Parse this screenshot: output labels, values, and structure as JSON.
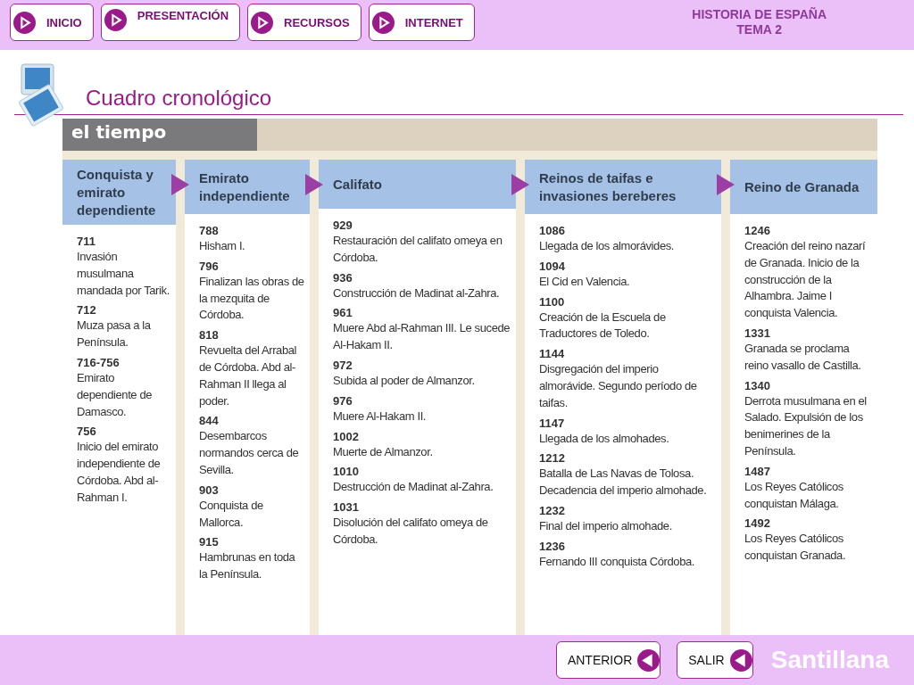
{
  "nav": [
    {
      "label": "INICIO"
    },
    {
      "label": "PRESENTACIÓN"
    },
    {
      "label": "RECURSOS"
    },
    {
      "label": "INTERNET"
    }
  ],
  "course": {
    "title": "HISTORIA DE ESPAÑA",
    "subtitle": "TEMA 2"
  },
  "page_title": "Cuadro cronológico",
  "band_label": "el tiempo",
  "columns": [
    {
      "heading": "Conquista y emirato dependiente",
      "events": [
        {
          "year": "711",
          "text": "Invasión musulmana mandada por Tarik."
        },
        {
          "year": "712",
          "text": "Muza pasa a la Península."
        },
        {
          "year": "716-756",
          "text": "Emirato dependiente de Damasco."
        },
        {
          "year": "756",
          "text": "Inicio del emirato independiente de Córdoba. Abd al-Rahman I."
        }
      ]
    },
    {
      "heading": "Emirato independiente",
      "events": [
        {
          "year": "788",
          "text": "Hisham I."
        },
        {
          "year": "796",
          "text": "Finalizan las obras de la mezquita de Córdoba."
        },
        {
          "year": "818",
          "text": "Revuelta del Arrabal de Córdoba. Abd al-Rahman II llega al poder."
        },
        {
          "year": "844",
          "text": "Desembarcos normandos cerca de Sevilla."
        },
        {
          "year": "903",
          "text": "Conquista de Mallorca."
        },
        {
          "year": "915",
          "text": "Hambrunas en toda la Península."
        }
      ]
    },
    {
      "heading": "Califato",
      "events": [
        {
          "year": "929",
          "text": "Restauración del califato omeya en Córdoba."
        },
        {
          "year": "936",
          "text": "Construcción de Madinat al-Zahra."
        },
        {
          "year": "961",
          "text": "Muere Abd al-Rahman III. Le sucede Al-Hakam II."
        },
        {
          "year": "972",
          "text": "Subida al poder de Almanzor."
        },
        {
          "year": "976",
          "text": "Muere Al-Hakam II."
        },
        {
          "year": "1002",
          "text": "Muerte de Almanzor."
        },
        {
          "year": "1010",
          "text": "Destrucción de Madinat al-Zahra."
        },
        {
          "year": "1031",
          "text": "Disolución del califato omeya de Córdoba."
        }
      ]
    },
    {
      "heading": "Reinos de taifas e invasiones bereberes",
      "events": [
        {
          "year": "1086",
          "text": "Llegada de los almorávides."
        },
        {
          "year": "1094",
          "text": "El Cid en Valencia."
        },
        {
          "year": "1100",
          "text": "Creación de la Escuela de Traductores de Toledo."
        },
        {
          "year": "1144",
          "text": "Disgregación del imperio almorávide. Segundo período de taifas."
        },
        {
          "year": "1147",
          "text": "Llegada de los almohades."
        },
        {
          "year": "1212",
          "text": "Batalla de Las Navas de Tolosa. Decadencia del imperio almohade."
        },
        {
          "year": "1232",
          "text": "Final del imperio almohade."
        },
        {
          "year": "1236",
          "text": "Fernando III conquista Córdoba."
        }
      ]
    },
    {
      "heading": "Reino de Granada",
      "events": [
        {
          "year": "1246",
          "text": "Creación del reino nazarí de Granada. Inicio de la construcción de la Alhambra. Jaime I conquista Valencia."
        },
        {
          "year": "1331",
          "text": "Granada se proclama reino vasallo de Castilla."
        },
        {
          "year": "1340",
          "text": "Derrota musulmana en el Salado. Expulsión de los benimerines de la Península."
        },
        {
          "year": "1487",
          "text": "Los Reyes Católicos conquistan Málaga."
        },
        {
          "year": "1492",
          "text": "Los Reyes Católicos conquistan Granada."
        }
      ]
    }
  ],
  "footer_buttons": [
    {
      "label": "ANTERIOR"
    },
    {
      "label": "SALIR"
    }
  ],
  "brand": "Santillana"
}
